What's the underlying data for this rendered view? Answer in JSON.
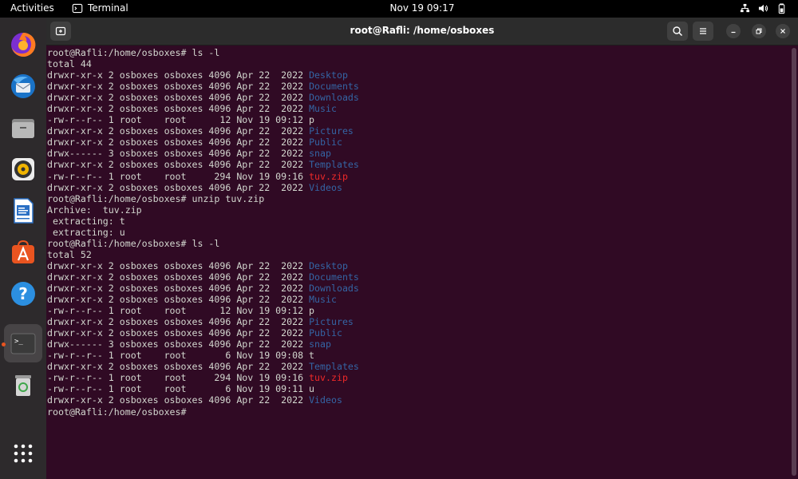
{
  "topbar": {
    "activities": "Activities",
    "app_name": "Terminal",
    "clock": "Nov 19  09:17"
  },
  "dock": {
    "items": [
      "firefox-icon",
      "thunderbird-icon",
      "files-icon",
      "rhythmbox-icon",
      "libreoffice-writer-icon",
      "app-center-icon",
      "help-icon",
      "terminal-icon",
      "trash-icon",
      "show-apps-icon"
    ],
    "accent": "#e95420"
  },
  "window": {
    "title": "root@Rafli: /home/osboxes"
  },
  "terminal": {
    "colors": {
      "background": "#300a24",
      "text": "#d3d7cf",
      "dir": "#3465a4",
      "zip": "#ef2929"
    },
    "lines": [
      [
        [
          "root@Rafli:/home/osboxes# ls -l",
          ""
        ]
      ],
      [
        [
          "total 44",
          ""
        ]
      ],
      [
        [
          "drwxr-xr-x 2 osboxes osboxes 4096 Apr 22  2022 ",
          ""
        ],
        [
          "Desktop",
          "dir"
        ]
      ],
      [
        [
          "drwxr-xr-x 2 osboxes osboxes 4096 Apr 22  2022 ",
          ""
        ],
        [
          "Documents",
          "dir"
        ]
      ],
      [
        [
          "drwxr-xr-x 2 osboxes osboxes 4096 Apr 22  2022 ",
          ""
        ],
        [
          "Downloads",
          "dir"
        ]
      ],
      [
        [
          "drwxr-xr-x 2 osboxes osboxes 4096 Apr 22  2022 ",
          ""
        ],
        [
          "Music",
          "dir"
        ]
      ],
      [
        [
          "-rw-r--r-- 1 root    root      12 Nov 19 09:12 p",
          ""
        ]
      ],
      [
        [
          "drwxr-xr-x 2 osboxes osboxes 4096 Apr 22  2022 ",
          ""
        ],
        [
          "Pictures",
          "dir"
        ]
      ],
      [
        [
          "drwxr-xr-x 2 osboxes osboxes 4096 Apr 22  2022 ",
          ""
        ],
        [
          "Public",
          "dir"
        ]
      ],
      [
        [
          "drwx------ 3 osboxes osboxes 4096 Apr 22  2022 ",
          ""
        ],
        [
          "snap",
          "dir"
        ]
      ],
      [
        [
          "drwxr-xr-x 2 osboxes osboxes 4096 Apr 22  2022 ",
          ""
        ],
        [
          "Templates",
          "dir"
        ]
      ],
      [
        [
          "-rw-r--r-- 1 root    root     294 Nov 19 09:16 ",
          ""
        ],
        [
          "tuv.zip",
          "zip"
        ]
      ],
      [
        [
          "drwxr-xr-x 2 osboxes osboxes 4096 Apr 22  2022 ",
          ""
        ],
        [
          "Videos",
          "dir"
        ]
      ],
      [
        [
          "root@Rafli:/home/osboxes# unzip tuv.zip",
          ""
        ]
      ],
      [
        [
          "Archive:  tuv.zip",
          ""
        ]
      ],
      [
        [
          " extracting: t",
          ""
        ]
      ],
      [
        [
          " extracting: u",
          ""
        ]
      ],
      [
        [
          "root@Rafli:/home/osboxes# ls -l",
          ""
        ]
      ],
      [
        [
          "total 52",
          ""
        ]
      ],
      [
        [
          "drwxr-xr-x 2 osboxes osboxes 4096 Apr 22  2022 ",
          ""
        ],
        [
          "Desktop",
          "dir"
        ]
      ],
      [
        [
          "drwxr-xr-x 2 osboxes osboxes 4096 Apr 22  2022 ",
          ""
        ],
        [
          "Documents",
          "dir"
        ]
      ],
      [
        [
          "drwxr-xr-x 2 osboxes osboxes 4096 Apr 22  2022 ",
          ""
        ],
        [
          "Downloads",
          "dir"
        ]
      ],
      [
        [
          "drwxr-xr-x 2 osboxes osboxes 4096 Apr 22  2022 ",
          ""
        ],
        [
          "Music",
          "dir"
        ]
      ],
      [
        [
          "-rw-r--r-- 1 root    root      12 Nov 19 09:12 p",
          ""
        ]
      ],
      [
        [
          "drwxr-xr-x 2 osboxes osboxes 4096 Apr 22  2022 ",
          ""
        ],
        [
          "Pictures",
          "dir"
        ]
      ],
      [
        [
          "drwxr-xr-x 2 osboxes osboxes 4096 Apr 22  2022 ",
          ""
        ],
        [
          "Public",
          "dir"
        ]
      ],
      [
        [
          "drwx------ 3 osboxes osboxes 4096 Apr 22  2022 ",
          ""
        ],
        [
          "snap",
          "dir"
        ]
      ],
      [
        [
          "-rw-r--r-- 1 root    root       6 Nov 19 09:08 t",
          ""
        ]
      ],
      [
        [
          "drwxr-xr-x 2 osboxes osboxes 4096 Apr 22  2022 ",
          ""
        ],
        [
          "Templates",
          "dir"
        ]
      ],
      [
        [
          "-rw-r--r-- 1 root    root     294 Nov 19 09:16 ",
          ""
        ],
        [
          "tuv.zip",
          "zip"
        ]
      ],
      [
        [
          "-rw-r--r-- 1 root    root       6 Nov 19 09:11 u",
          ""
        ]
      ],
      [
        [
          "drwxr-xr-x 2 osboxes osboxes 4096 Apr 22  2022 ",
          ""
        ],
        [
          "Videos",
          "dir"
        ]
      ],
      [
        [
          "root@Rafli:/home/osboxes# ",
          ""
        ]
      ]
    ]
  }
}
